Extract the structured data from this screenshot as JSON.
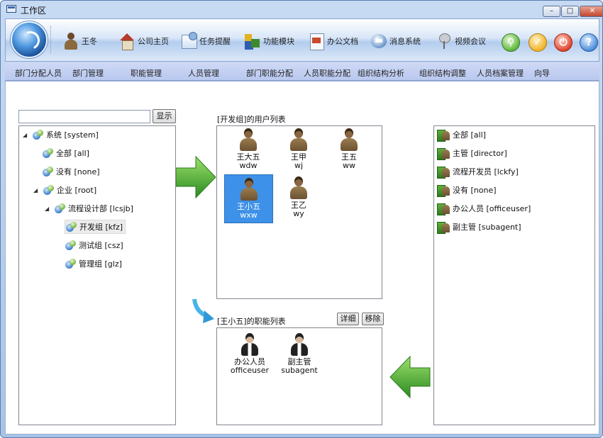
{
  "window": {
    "title": "工作区",
    "min": "–",
    "max": "□",
    "close": "✕"
  },
  "toolbar": {
    "user": "王冬",
    "home": "公司主页",
    "task": "任务提醒",
    "modules": "功能模块",
    "docs": "办公文档",
    "msg": "消息系统",
    "video": "视频会议"
  },
  "menu": [
    "部门分配人员",
    "部门管理",
    "职能管理",
    "人员管理",
    "部门职能分配",
    "人员职能分配",
    "组织结构分析",
    "组织结构调整",
    "人员档案管理",
    "向导"
  ],
  "left": {
    "search_value": "",
    "show_btn": "显示",
    "tree": [
      {
        "label": "系统 [system]",
        "expander": "◢"
      },
      {
        "label": "全部 [all]",
        "expander": ""
      },
      {
        "label": "没有 [none]",
        "expander": ""
      },
      {
        "label": "企业 [root]",
        "expander": "◢"
      },
      {
        "label": "流程设计部 [lcsjb]",
        "expander": "◢"
      },
      {
        "label": "开发组 [kfz]",
        "expander": ""
      },
      {
        "label": "测试组 [csz]",
        "expander": ""
      },
      {
        "label": "管理组 [glz]",
        "expander": ""
      }
    ]
  },
  "users": {
    "title": "[开发组]的用户列表",
    "list": [
      {
        "name": "王大五",
        "code": "wdw"
      },
      {
        "name": "王甲",
        "code": "wj"
      },
      {
        "name": "王五",
        "code": "ww"
      },
      {
        "name": "王小五",
        "code": "wxw"
      },
      {
        "name": "王乙",
        "code": "wy"
      }
    ]
  },
  "duties": {
    "title": "[王小五]的职能列表",
    "detail_btn": "详细",
    "remove_btn": "移除",
    "list": [
      {
        "name": "办公人员",
        "code": "officeuser"
      },
      {
        "name": "副主管",
        "code": "subagent"
      }
    ]
  },
  "roles": [
    "全部 [all]",
    "主管 [director]",
    "流程开发员 [lckfy]",
    "没有 [none]",
    "办公人员 [officeuser]",
    "副主管 [subagent]"
  ],
  "colors": {
    "accent": "#3d91e8",
    "arrow_green": "#3aa532"
  }
}
